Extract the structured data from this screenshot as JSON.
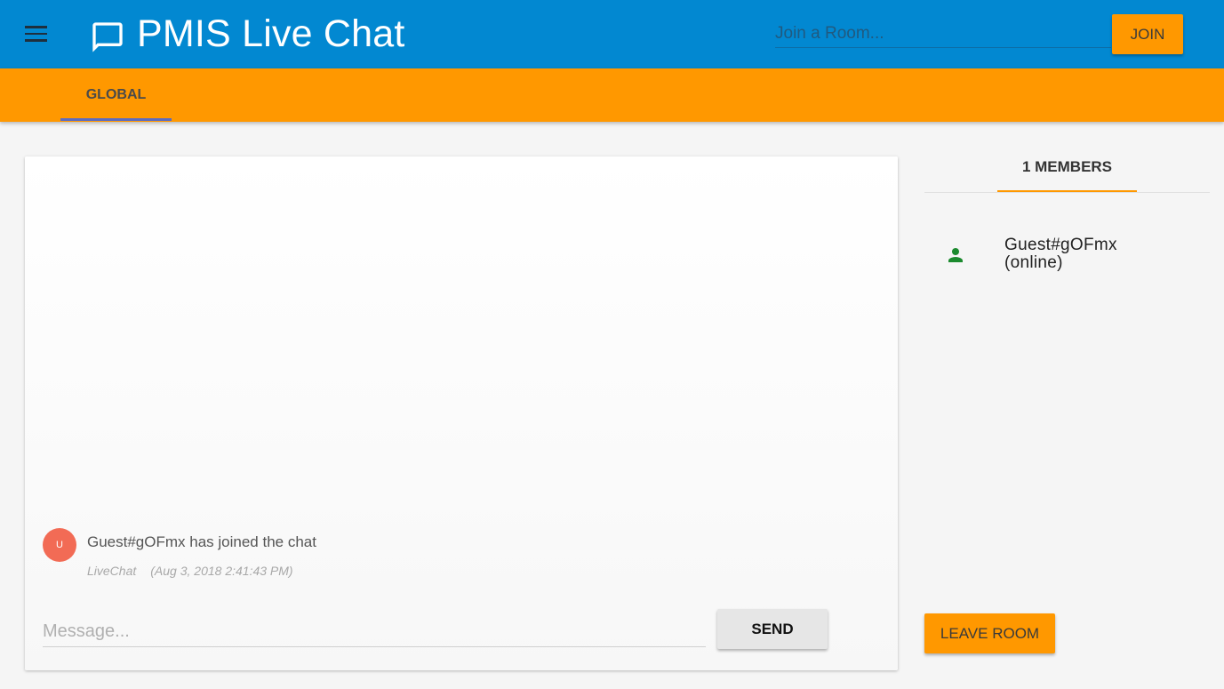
{
  "header": {
    "title": "PMIS Live Chat",
    "menu_icon": "hamburger-menu-icon",
    "logo_icon": "chat-bubble-icon",
    "join_placeholder": "Join a Room...",
    "join_label": "JOIN"
  },
  "tabs": [
    {
      "label": "GLOBAL",
      "active": true
    }
  ],
  "chat": {
    "messages": [
      {
        "avatar_initial": "U",
        "text": "Guest#gOFmx has joined the chat",
        "sender": "LiveChat",
        "time": "(Aug 3, 2018 2:41:43 PM)"
      }
    ],
    "message_placeholder": "Message...",
    "send_label": "SEND"
  },
  "members": {
    "tab_label": "1 MEMBERS",
    "items": [
      {
        "name": "Guest#gOFmx",
        "status": "(online)",
        "icon": "person-icon"
      }
    ],
    "leave_label": "LEAVE ROOM"
  },
  "colors": {
    "appbar": "#0288d1",
    "accent": "#ff9800",
    "tab_indicator": "#5c6bc0",
    "avatar": "#f26b55",
    "online_icon": "#1b8a2e"
  }
}
